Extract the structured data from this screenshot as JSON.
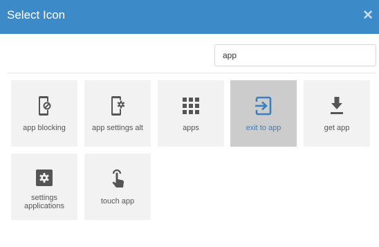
{
  "dialog": {
    "title": "Select Icon",
    "close_symbol": "✕"
  },
  "search": {
    "value": "app",
    "placeholder": ""
  },
  "icons": [
    {
      "label": "app blocking",
      "icon": "app-blocking-icon",
      "selected": false
    },
    {
      "label": "app settings alt",
      "icon": "app-settings-alt-icon",
      "selected": false
    },
    {
      "label": "apps",
      "icon": "apps-icon",
      "selected": false
    },
    {
      "label": "exit to app",
      "icon": "exit-to-app-icon",
      "selected": true
    },
    {
      "label": "get app",
      "icon": "get-app-icon",
      "selected": false
    },
    {
      "label": "settings applications",
      "icon": "settings-applications-icon",
      "selected": false
    },
    {
      "label": "touch app",
      "icon": "touch-app-icon",
      "selected": false
    }
  ],
  "colors": {
    "header": "#3d8ac8",
    "icon": "#555555",
    "selected_icon": "#3d7fb8",
    "tile": "#f2f2f2",
    "selected_tile": "#cccccc"
  }
}
